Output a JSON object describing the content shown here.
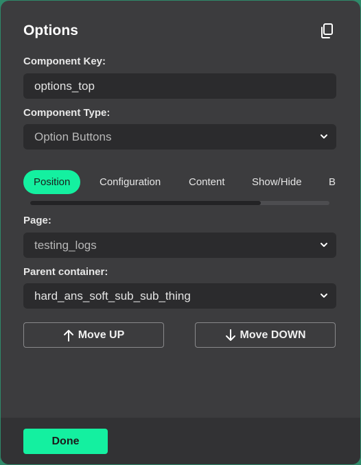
{
  "dialog": {
    "title": "Options",
    "copy_icon": "copy-icon"
  },
  "component_key": {
    "label": "Component Key:",
    "value": "options_top"
  },
  "component_type": {
    "label": "Component Type:",
    "value": "Option Buttons",
    "icon": "chevron-down-icon"
  },
  "tabs": [
    {
      "label": "Position",
      "active": true
    },
    {
      "label": "Configuration",
      "active": false
    },
    {
      "label": "Content",
      "active": false
    },
    {
      "label": "Show/Hide",
      "active": false
    },
    {
      "label": "B",
      "active": false
    }
  ],
  "tab_scroll": {
    "position_fraction": 0.77
  },
  "page": {
    "label": "Page:",
    "value": "testing_logs"
  },
  "parent_container": {
    "label": "Parent container:",
    "value": "hard_ans_soft_sub_sub_thing"
  },
  "actions": {
    "move_up": "Move UP",
    "move_up_icon": "arrow-up-icon",
    "move_down": "Move DOWN",
    "move_down_icon": "arrow-down-icon"
  },
  "footer": {
    "done": "Done"
  },
  "colors": {
    "accent": "#14f0a0",
    "panel": "#3c3c3e",
    "field": "#2b2b2d"
  }
}
